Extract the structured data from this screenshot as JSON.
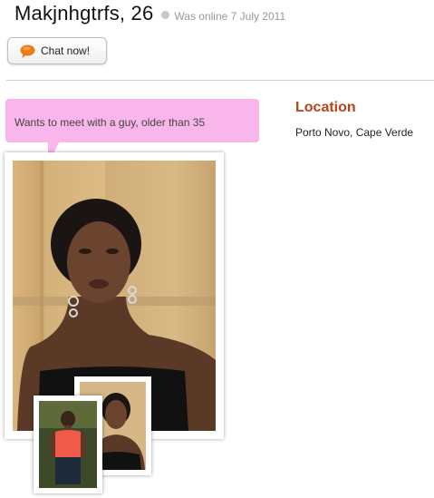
{
  "profile": {
    "name": "Makjnhgtrfs, 26",
    "online_status": "Was online 7 July 2011"
  },
  "chat_button": {
    "label": "Chat now!",
    "icon": "speech-bubble-icon",
    "icon_color": "#f07a13"
  },
  "intent": {
    "text": "Wants to meet with a guy, older than 35",
    "bubble_color": "#f9b6ea"
  },
  "location": {
    "title": "Location",
    "value": "Porto Novo, Cape Verde",
    "title_color": "#b8431b"
  },
  "photos": {
    "main": "profile-photo",
    "thumbnails": [
      "thumbnail-photo-1",
      "thumbnail-photo-2"
    ]
  }
}
